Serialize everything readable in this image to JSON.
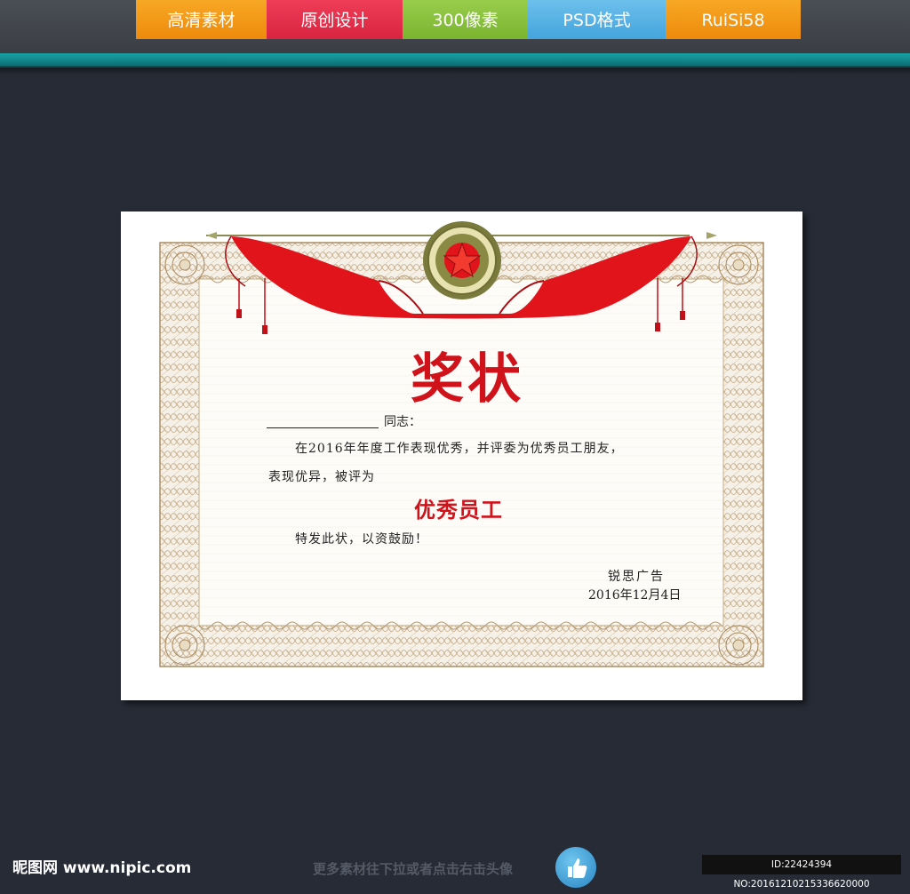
{
  "header": {
    "tabs": [
      {
        "label": "高清素材",
        "color": "#f39c12"
      },
      {
        "label": "原创设计",
        "color": "#e8344e"
      },
      {
        "label": "300像素",
        "color": "#8cc63f"
      },
      {
        "label": "PSD格式",
        "color": "#58b4e6"
      },
      {
        "label": "RuiSi58",
        "color": "#f39c12"
      }
    ]
  },
  "certificate": {
    "title": "奖状",
    "comrade_suffix": "同志：",
    "line1": "在2016年年度工作表现优秀，并评委为优秀员工朋友，",
    "line2": "表现优异，被评为",
    "award": "优秀员工",
    "line3": "特发此状，以资鼓励！",
    "issuer": "锐思广告",
    "date": "2016年12月4日",
    "colors": {
      "title": "#d0121b",
      "ribbon": "#e1141c",
      "frame": "#b59a72"
    }
  },
  "footer": {
    "logo_text": "昵图网 www.nipic.com",
    "hint": "更多素材往下拉或者点击右击头像",
    "like_icon": "thumbs-up-icon",
    "id_text": "ID:22424394 NO:20161210215336620000"
  }
}
